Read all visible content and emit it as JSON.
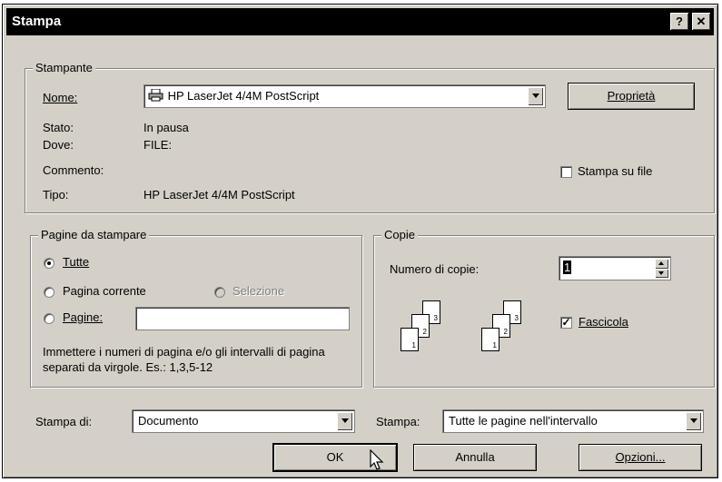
{
  "window": {
    "title": "Stampa",
    "help_button": "?",
    "close_button": "✕"
  },
  "printer": {
    "group_label": "Stampante",
    "name_label": "Nome:",
    "name_value": "HP LaserJet 4/4M PostScript",
    "properties_button": "Proprietà",
    "status_label": "Stato:",
    "status_value": "In pausa",
    "where_label": "Dove:",
    "where_value": "FILE:",
    "comment_label": "Commento:",
    "type_label": "Tipo:",
    "type_value": "HP LaserJet 4/4M PostScript",
    "print_to_file_label": "Stampa su file",
    "print_to_file_checked": false
  },
  "pages": {
    "group_label": "Pagine da stampare",
    "all_label": "Tutte",
    "current_label": "Pagina corrente",
    "selection_label": "Selezione",
    "pages_label": "Pagine:",
    "pages_value": "",
    "hint": "Immettere i numeri di pagina e/o gli intervalli di pagina separati da virgole. Es.: 1,3,5-12",
    "selected": "all"
  },
  "copies": {
    "group_label": "Copie",
    "number_label": "Numero di copie:",
    "number_value": "1",
    "collate_label": "Fascicola",
    "collate_checked": true,
    "collated_icon": [
      "1",
      "2",
      "3"
    ],
    "uncollated_icon": [
      "1",
      "2",
      "3"
    ]
  },
  "bottom": {
    "print_what_label": "Stampa di:",
    "print_what_value": "Documento",
    "print_label": "Stampa:",
    "print_value": "Tutte le pagine nell'intervallo",
    "ok_button": "OK",
    "cancel_button": "Annulla",
    "options_button": "Opzioni..."
  }
}
